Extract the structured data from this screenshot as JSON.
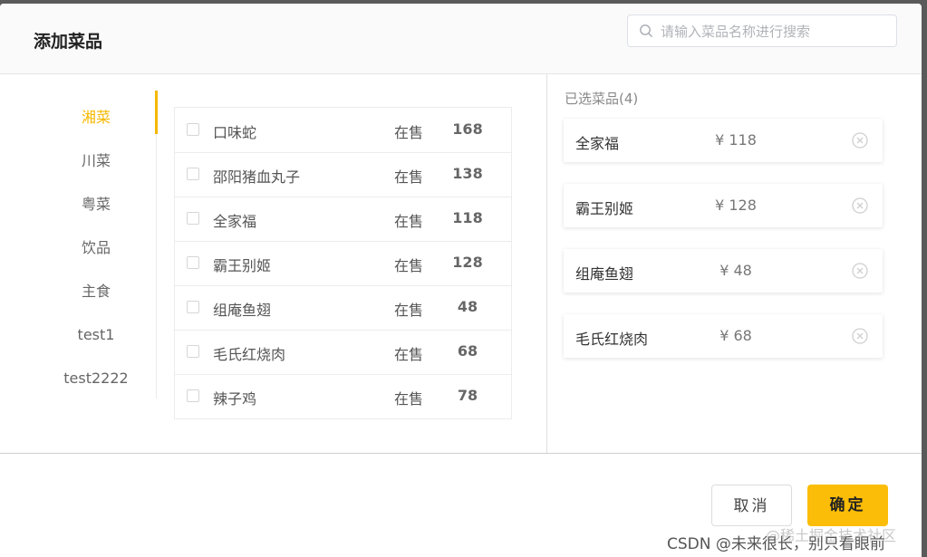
{
  "dialog": {
    "title": "添加菜品",
    "search_placeholder": "请输入菜品名称进行搜索"
  },
  "categories": [
    {
      "label": "湘菜",
      "active": true
    },
    {
      "label": "川菜",
      "active": false
    },
    {
      "label": "粤菜",
      "active": false
    },
    {
      "label": "饮品",
      "active": false
    },
    {
      "label": "主食",
      "active": false
    },
    {
      "label": "test1",
      "active": false
    },
    {
      "label": "test2222",
      "active": false
    }
  ],
  "dishes": [
    {
      "name": "口味蛇",
      "status": "在售",
      "price": "168"
    },
    {
      "name": "邵阳猪血丸子",
      "status": "在售",
      "price": "138"
    },
    {
      "name": "全家福",
      "status": "在售",
      "price": "118"
    },
    {
      "name": "霸王别姬",
      "status": "在售",
      "price": "128"
    },
    {
      "name": "组庵鱼翅",
      "status": "在售",
      "price": "48"
    },
    {
      "name": "毛氏红烧肉",
      "status": "在售",
      "price": "68"
    },
    {
      "name": "辣子鸡",
      "status": "在售",
      "price": "78"
    }
  ],
  "selected": {
    "header": "已选菜品(4)",
    "items": [
      {
        "name": "全家福",
        "price": "¥ 118"
      },
      {
        "name": "霸王别姬",
        "price": "¥ 128"
      },
      {
        "name": "组庵鱼翅",
        "price": "¥ 48"
      },
      {
        "name": "毛氏红烧肉",
        "price": "¥ 68"
      }
    ]
  },
  "footer": {
    "cancel_label": "取消",
    "confirm_label": "确定"
  },
  "watermark": {
    "text": "CSDN @未来很长，别只看眼前",
    "text2": "@稀土掘金技术社区"
  },
  "colors": {
    "accent": "#fbbd08",
    "active_category": "#f5b800"
  }
}
